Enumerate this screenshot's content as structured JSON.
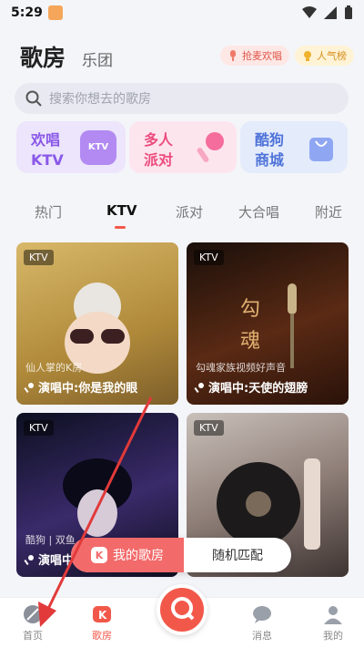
{
  "status": {
    "time": "5:29"
  },
  "header": {
    "title": "歌房",
    "subtitle": "乐团",
    "grab_label": "抢麦欢唱",
    "popular_label": "人气榜"
  },
  "search": {
    "placeholder": "搜索你想去的歌房"
  },
  "quick": [
    {
      "label": "欢唱\nKTV",
      "icon_text": "KTV"
    },
    {
      "label": "多人\n派对"
    },
    {
      "label": "酷狗\n商城"
    }
  ],
  "tabs": [
    "热门",
    "KTV",
    "派对",
    "大合唱",
    "附近"
  ],
  "rooms": [
    {
      "badge": "KTV",
      "owner": "仙人掌的K房",
      "playing": "演唱中:你是我的眼"
    },
    {
      "badge": "KTV",
      "owner": "勾魂家族视频好声音",
      "playing": "演唱中:天使的翅膀"
    },
    {
      "badge": "KTV",
      "owner": "酷狗 | 双鱼",
      "playing": "演唱中:你"
    },
    {
      "badge": "KTV",
      "owner": "",
      "playing": ""
    }
  ],
  "floatbar": {
    "my_room": "我的歌房",
    "random": "随机匹配"
  },
  "nav": [
    {
      "label": "首页",
      "icon": "home-icon"
    },
    {
      "label": "歌房",
      "icon": "kroom-icon"
    },
    {
      "label": "消息",
      "icon": "message-icon"
    },
    {
      "label": "我的",
      "icon": "profile-icon"
    }
  ],
  "colors": {
    "accent": "#f2584a",
    "ktv": "#8a58e8",
    "party": "#ec4d7f",
    "mall": "#4f73d9"
  }
}
